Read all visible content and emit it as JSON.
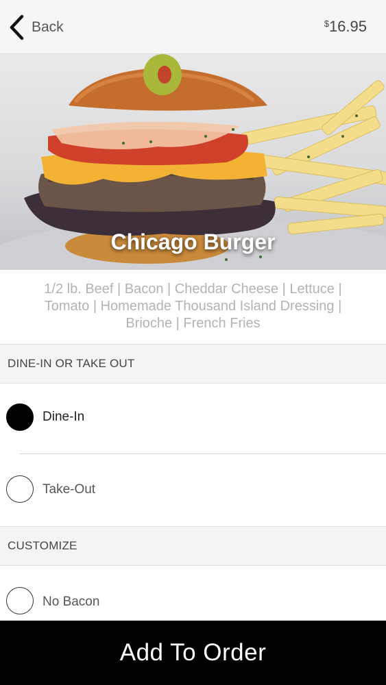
{
  "header": {
    "back_label": "Back",
    "price_currency": "$",
    "price_amount": "16.95"
  },
  "item": {
    "name": "Chicago Burger",
    "description": "1/2 lb. Beef | Bacon | Cheddar Cheese | Lettuce | Tomato | Homemade Thousand Island Dressing | Brioche | French Fries"
  },
  "sections": [
    {
      "title": "DINE-IN OR TAKE OUT",
      "options": [
        {
          "label": "Dine-In",
          "selected": true
        },
        {
          "label": "Take-Out",
          "selected": false
        }
      ]
    },
    {
      "title": "CUSTOMIZE",
      "options": [
        {
          "label": "No Bacon",
          "selected": false
        }
      ]
    }
  ],
  "footer": {
    "add_label": "Add To Order"
  },
  "colors": {
    "header_bg": "#f6f6f6",
    "button_bg": "#000000",
    "radio_selected": "#000000",
    "description_text": "#b3b3b3"
  },
  "icons": {
    "back": "chevron-left-icon",
    "radio_on": "radio-selected-icon",
    "radio_off": "radio-unselected-icon"
  }
}
